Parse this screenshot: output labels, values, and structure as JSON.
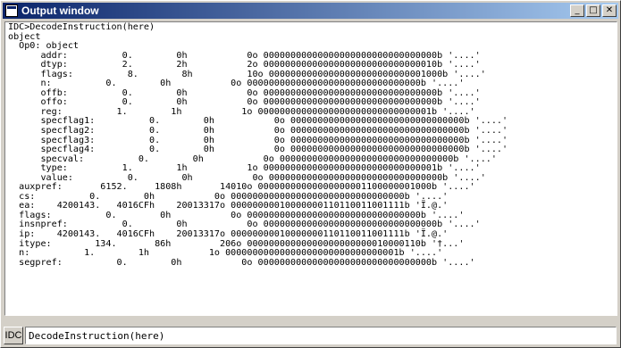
{
  "window": {
    "title": "Output window",
    "icon": "output-window-icon"
  },
  "titlebar_buttons": {
    "minimize": "_",
    "maximize": "□",
    "close": "✕"
  },
  "output": {
    "text": "IDC>DecodeInstruction(here)\nobject\n  Op0: object\n      addr:          0.        0h           0o 00000000000000000000000000000000b '....'\n      dtyp:          2.        2h           2o 00000000000000000000000000000010b '....'\n      flags:          8.        8h          10o 00000000000000000000000000001000b '....'\n      n:          0.        0h           0o 00000000000000000000000000000000b '....'\n      offb:          0.        0h           0o 00000000000000000000000000000000b '....'\n      offo:          0.        0h           0o 00000000000000000000000000000000b '....'\n      reg:          1.        1h           1o 00000000000000000000000000000001b '....'\n      specflag1:          0.        0h           0o 00000000000000000000000000000000b '....'\n      specflag2:          0.        0h           0o 00000000000000000000000000000000b '....'\n      specflag3:          0.        0h           0o 00000000000000000000000000000000b '....'\n      specflag4:          0.        0h           0o 00000000000000000000000000000000b '....'\n      specval:          0.        0h           0o 00000000000000000000000000000000b '....'\n      type:          1.        1h           1o 00000000000000000000000000000001b '....'\n      value:          0.        0h           0o 00000000000000000000000000000000b '....'\n  auxpref:       6152.     1808h       14010o 00000000000000000001100000001000b '....'\n  cs:          0.        0h           0o 00000000000000000000000000000000b '....'\n  ea:    4200143.   4016CFh    20013317o 00000000010000000110110011001111b 'Ï.@.'\n  flags:          0.        0h           0o 00000000000000000000000000000000b '....'\n  insnpref:          0.        0h           0o 00000000000000000000000000000000b '....'\n  ip:    4200143.   4016CFh    20013317o 00000000010000000110110011001111b 'Ï.@.'\n  itype:        134.       86h         206o 00000000000000000000000010000110b '†...'\n  n:          1.        1h           1o 00000000000000000000000000000001b '....'\n  segpref:          0.        0h           0o 00000000000000000000000000000000b '....'"
  },
  "command": {
    "label": "IDC",
    "value": "DecodeInstruction(here)"
  }
}
